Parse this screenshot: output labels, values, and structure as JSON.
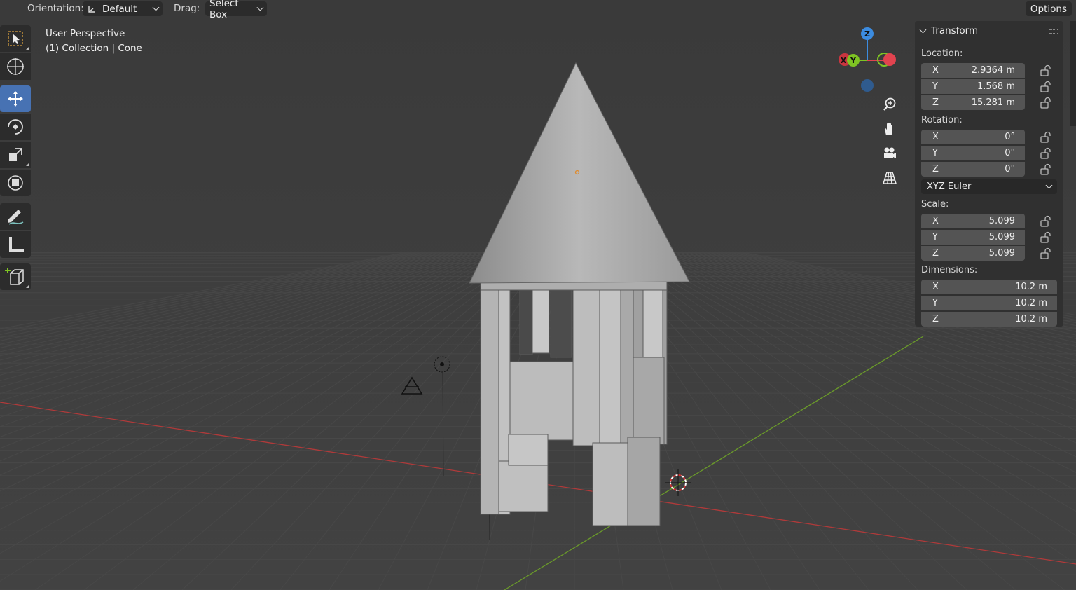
{
  "header": {
    "orientation_label": "Orientation:",
    "orientation_value": "Default",
    "drag_label": "Drag:",
    "drag_value": "Select Box",
    "options_label": "Options"
  },
  "viewport": {
    "view_name": "User Perspective",
    "context": "(1) Collection | Cone"
  },
  "toolbar": {
    "tools": [
      "select-box",
      "cursor",
      "move",
      "rotate",
      "scale",
      "transform",
      "annotate",
      "measure",
      "add-cube"
    ],
    "active_tool": "move"
  },
  "gizmo": {
    "axes": [
      "Z",
      "Y",
      "X"
    ],
    "colors": {
      "x": "#e2434f",
      "y": "#7ec423",
      "z": "#3c8ce0"
    }
  },
  "transform": {
    "title": "Transform",
    "location_label": "Location:",
    "location": [
      {
        "axis": "X",
        "value": "2.9364 m"
      },
      {
        "axis": "Y",
        "value": "1.568 m"
      },
      {
        "axis": "Z",
        "value": "15.281 m"
      }
    ],
    "rotation_label": "Rotation:",
    "rotation": [
      {
        "axis": "X",
        "value": "0°"
      },
      {
        "axis": "Y",
        "value": "0°"
      },
      {
        "axis": "Z",
        "value": "0°"
      }
    ],
    "rotation_mode": "XYZ Euler",
    "scale_label": "Scale:",
    "scale": [
      {
        "axis": "X",
        "value": "5.099"
      },
      {
        "axis": "Y",
        "value": "5.099"
      },
      {
        "axis": "Z",
        "value": "5.099"
      }
    ],
    "dimensions_label": "Dimensions:",
    "dimensions": [
      {
        "axis": "X",
        "value": "10.2 m"
      },
      {
        "axis": "Y",
        "value": "10.2 m"
      },
      {
        "axis": "Z",
        "value": "10.2 m"
      }
    ]
  },
  "colors": {
    "accent": "#4772b3",
    "background": "#3d3d3d",
    "x_axis_line": "#b03a3a",
    "y_axis_line": "#6a9a2a"
  }
}
